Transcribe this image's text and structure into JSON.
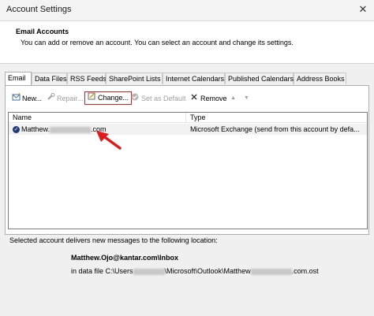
{
  "window": {
    "title": "Account Settings",
    "close_glyph": "✕"
  },
  "header": {
    "title": "Email Accounts",
    "description": "You can add or remove an account. You can select an account and change its settings."
  },
  "tabs": [
    {
      "label": "Email"
    },
    {
      "label": "Data Files"
    },
    {
      "label": "RSS Feeds"
    },
    {
      "label": "SharePoint Lists"
    },
    {
      "label": "Internet Calendars"
    },
    {
      "label": "Published Calendars"
    },
    {
      "label": "Address Books"
    }
  ],
  "toolbar": {
    "new_label": "New...",
    "repair_label": "Repair...",
    "change_label": "Change...",
    "set_default_label": "Set as Default",
    "remove_label": "Remove",
    "up_glyph": "▲",
    "down_glyph": "▼"
  },
  "list": {
    "columns": {
      "name": "Name",
      "type": "Type"
    },
    "rows": [
      {
        "name_prefix": "Matthew.",
        "name_suffix": ".com",
        "type": "Microsoft Exchange (send from this account by defa..."
      }
    ]
  },
  "footer": {
    "deliver_text": "Selected account delivers new messages to the following location:",
    "inbox_path": "Matthew.Ojo@kantar.com\\Inbox",
    "datafile_prefix": "in data file C:\\Users",
    "datafile_middle": "\\Microsoft\\Outlook\\Matthew",
    "datafile_suffix": ".com.ost"
  },
  "colors": {
    "highlight": "#d62020",
    "check_icon": "#1f3b7a"
  }
}
